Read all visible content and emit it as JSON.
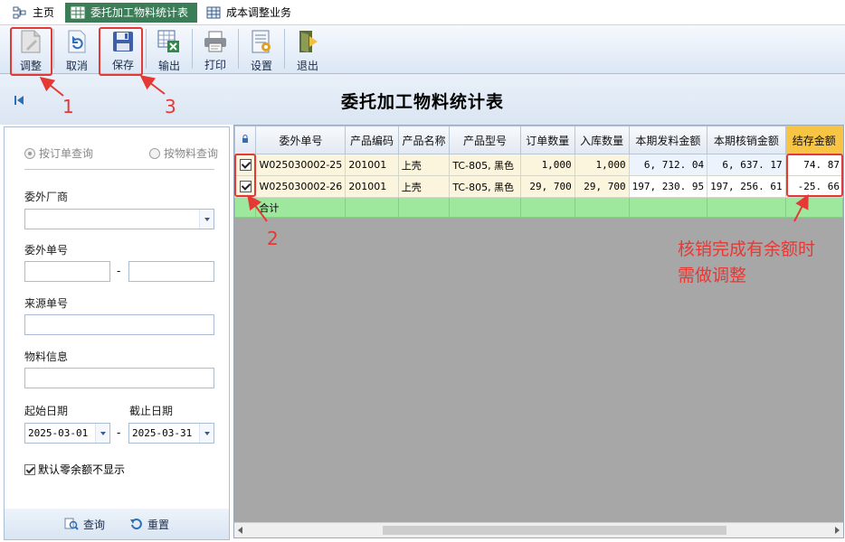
{
  "tabs": [
    {
      "label": "主页",
      "icon": "home-icon"
    },
    {
      "label": "委托加工物料统计表",
      "icon": "grid-table-icon",
      "active": true
    },
    {
      "label": "成本调整业务",
      "icon": "grid-table-icon"
    }
  ],
  "toolbar": {
    "adjust": "调整",
    "cancel": "取消",
    "save": "保存",
    "export": "输出",
    "print": "打印",
    "settings": "设置",
    "exit": "退出"
  },
  "page_title": "委托加工物料统计表",
  "query_panel": {
    "radio_by_order": "按订单查询",
    "radio_by_material": "按物料查询",
    "vendor_label": "委外厂商",
    "vendor_value": "",
    "order_no_label": "委外单号",
    "order_no_from": "",
    "order_no_to": "",
    "range_dash": "-",
    "source_no_label": "来源单号",
    "source_no_value": "",
    "material_label": "物料信息",
    "material_value": "",
    "start_date_label": "起始日期",
    "end_date_label": "截止日期",
    "start_date": "2025-03-01",
    "end_date": "2025-03-31",
    "hide_zero_label": "默认零余额不显示",
    "hide_zero_checked": true,
    "query_btn": "查询",
    "reset_btn": "重置"
  },
  "grid": {
    "columns": [
      "委外单号",
      "产品编码",
      "产品名称",
      "产品型号",
      "订单数量",
      "入库数量",
      "本期发料金额",
      "本期核销金额",
      "结存金额"
    ],
    "rows": [
      {
        "checked": true,
        "order_no": "W025030002-25",
        "code": "201001",
        "name": "上壳",
        "model": "TC-805, 黑色",
        "order_qty": "1,000",
        "in_qty": "1,000",
        "issue_amt": "6, 712. 04",
        "writeoff_amt": "6, 637. 17",
        "balance": "74. 87"
      },
      {
        "checked": true,
        "order_no": "W025030002-26",
        "code": "201001",
        "name": "上壳",
        "model": "TC-805, 黑色",
        "order_qty": "29, 700",
        "in_qty": "29, 700",
        "issue_amt": "197, 230. 95",
        "writeoff_amt": "197, 256. 61",
        "balance": "-25. 66"
      }
    ],
    "total_label": "合计"
  },
  "annotations": {
    "step1": "1",
    "step2": "2",
    "step3": "3",
    "note_line1": "核销完成有余额时",
    "note_line2": "需做调整",
    "color": "#e53935"
  },
  "colors": {
    "active_tab": "#3a7d57",
    "highlight_header": "#f7c444",
    "total_row": "#9ee89e",
    "row_bg": "#fbf5dd"
  }
}
